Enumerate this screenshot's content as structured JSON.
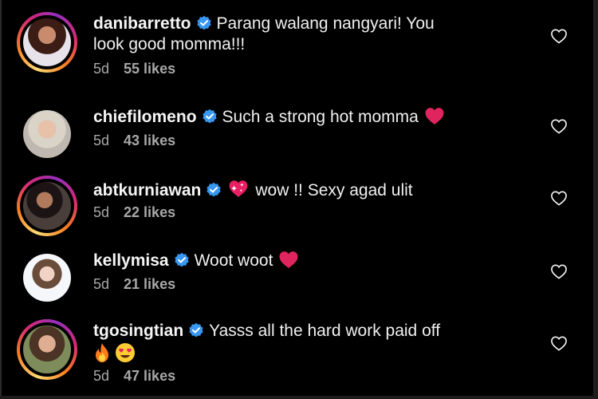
{
  "comments": [
    {
      "username": "danibarretto",
      "text_line1": "Parang walang nangyari! You",
      "text_line2": "look good momma!!!",
      "time": "5d",
      "likes": "55 likes",
      "has_story_ring": true,
      "trailing_emoji": []
    },
    {
      "username": "chiefilomeno",
      "text_line1": "Such a strong hot momma",
      "time": "5d",
      "likes": "43 likes",
      "has_story_ring": false,
      "trailing_emoji": [
        "red-heart"
      ]
    },
    {
      "username": "abtkurniawan",
      "leading_emoji": "sparkling-heart",
      "text_line1": "wow !! Sexy agad ulit",
      "time": "5d",
      "likes": "22 likes",
      "has_story_ring": true,
      "trailing_emoji": []
    },
    {
      "username": "kellymisa",
      "text_line1": "Woot woot",
      "time": "5d",
      "likes": "21 likes",
      "has_story_ring": false,
      "trailing_emoji": [
        "red-heart"
      ]
    },
    {
      "username": "tgosingtian",
      "text_line1": "Yasss all the hard work paid off",
      "text_line2_emoji": [
        "fire",
        "heart-eyes"
      ],
      "time": "5d",
      "likes": "47 likes",
      "has_story_ring": true,
      "trailing_emoji": []
    }
  ],
  "colors": {
    "background": "#000000",
    "username": "#f5f5f5",
    "meta": "#a8a8a8",
    "verified": "#3897f0",
    "heart_emoji": "#e0245e",
    "like_icon": "#f5f5f5"
  }
}
